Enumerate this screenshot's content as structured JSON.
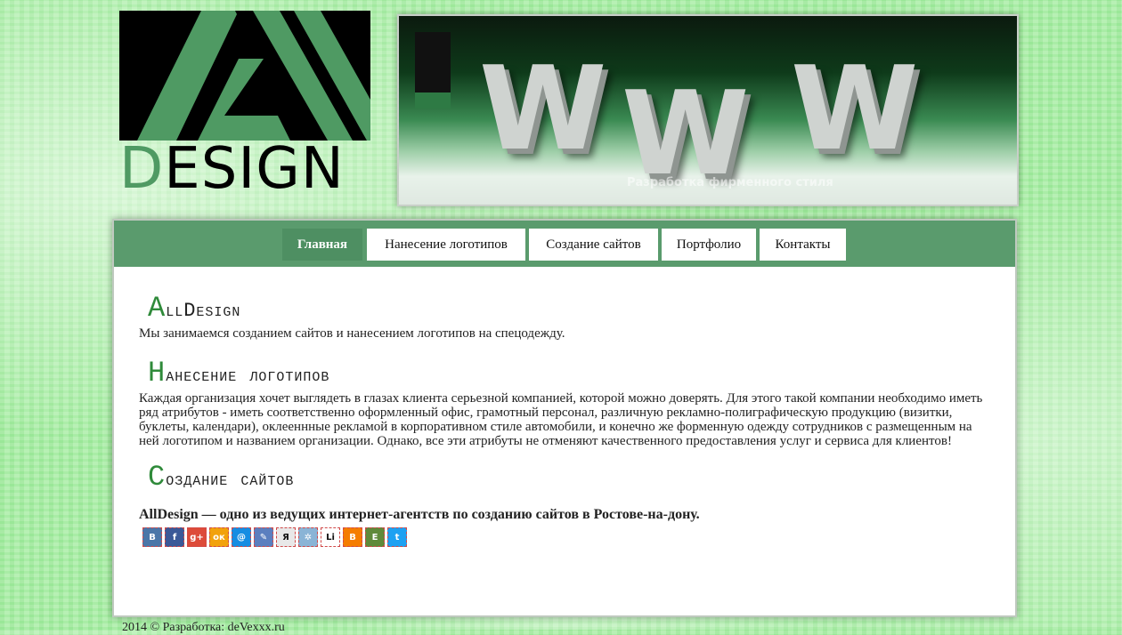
{
  "logo": {
    "text_prefix": "D",
    "text_rest": "ESIGN"
  },
  "banner": {
    "letters": [
      "W",
      "W",
      "W"
    ],
    "caption": "Разработка фирменного стиля"
  },
  "nav": {
    "items": [
      {
        "label": "Главная",
        "active": true
      },
      {
        "label": "Нанесение логотипов",
        "active": false
      },
      {
        "label": "Создание сайтов",
        "active": false
      },
      {
        "label": "Портфолио",
        "active": false
      },
      {
        "label": "Контакты",
        "active": false
      }
    ]
  },
  "sections": {
    "alldesign": {
      "title_cap": "A",
      "title_rest": "llDesign",
      "text": "Мы занимаемся созданием сайтов и нанесением логотипов на спецодежду."
    },
    "logos": {
      "title_cap": "Н",
      "title_rest": "анесение логотипов",
      "text": "Каждая организация хочет выглядеть в глазах клиента серьезной компанией, которой можно доверять. Для этого такой компании необходимо иметь ряд атрибутов - иметь соответственно оформленный офис, грамотный персонал, различную рекламно-полиграфическую продукцию (визитки, буклеты, календари), оклееннные рекламой в корпоративном стиле автомобили, и конечно же форменную одежду сотрудников с размещенным на ней логотипом и названием организации. Однако, все эти атрибуты не отменяют качественного предоставления услуг и сервиса для клиентов!"
    },
    "sites": {
      "title_cap": "С",
      "title_rest": "оздание сайтов",
      "text": "AllDesign — одно из ведущих интернет-агентств по созданию сайтов в Ростове-на-дону."
    }
  },
  "share_buttons": [
    {
      "icon": "vk-icon",
      "glyph": "B",
      "color": "#4a76a8"
    },
    {
      "icon": "facebook-icon",
      "glyph": "f",
      "color": "#3b5998"
    },
    {
      "icon": "google-plus-icon",
      "glyph": "g+",
      "color": "#dd4b39"
    },
    {
      "icon": "odnoklassniki-icon",
      "glyph": "ок",
      "color": "#f2a20c"
    },
    {
      "icon": "mailru-icon",
      "glyph": "@",
      "color": "#168de2"
    },
    {
      "icon": "bookmark-icon",
      "glyph": "✎",
      "color": "#5b7fbf"
    },
    {
      "icon": "yandex-icon",
      "glyph": "Я",
      "color": "#e8e8e8"
    },
    {
      "icon": "settings-icon",
      "glyph": "✲",
      "color": "#8ab4d6"
    },
    {
      "icon": "liveinternet-icon",
      "glyph": "Li",
      "color": "#ffffff"
    },
    {
      "icon": "blogger-icon",
      "glyph": "B",
      "color": "#f57d00"
    },
    {
      "icon": "evernote-icon",
      "glyph": "E",
      "color": "#5f8a3a"
    },
    {
      "icon": "twitter-icon",
      "glyph": "t",
      "color": "#1da1f2"
    }
  ],
  "footer": {
    "text": "2014 © Разработка: deVexxx.ru"
  }
}
